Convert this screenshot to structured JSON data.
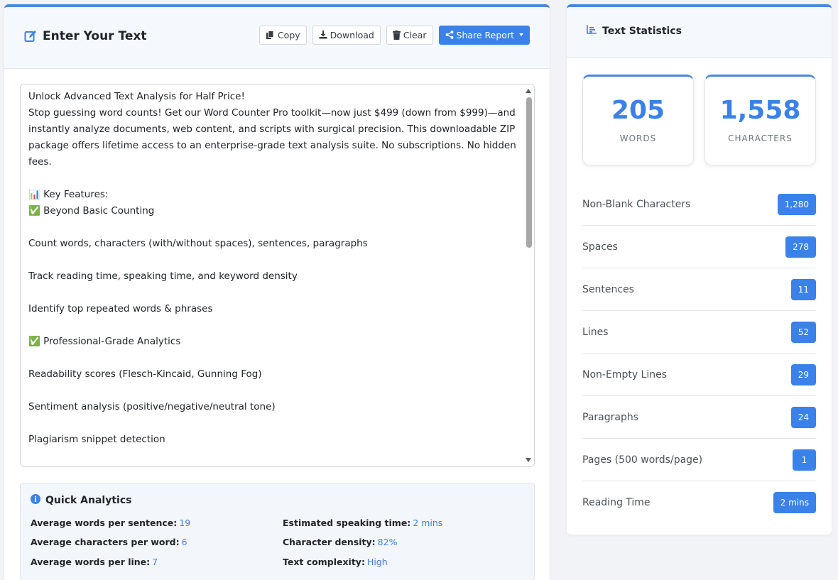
{
  "editor_panel": {
    "title": "Enter Your Text",
    "toolbar": {
      "copy": "Copy",
      "download": "Download",
      "clear": "Clear",
      "share": "Share Report"
    },
    "text": "Unlock Advanced Text Analysis for Half Price!\nStop guessing word counts! Get our Word Counter Pro toolkit—now just $499 (down from $999)—and instantly analyze documents, web content, and scripts with surgical precision. This downloadable ZIP package offers lifetime access to an enterprise-grade text analysis suite. No subscriptions. No hidden fees.\n\n📊 Key Features:\n✅ Beyond Basic Counting\n\nCount words, characters (with/without spaces), sentences, paragraphs\n\nTrack reading time, speaking time, and keyword density\n\nIdentify top repeated words & phrases\n\n✅ Professional-Grade Analytics\n\nReadability scores (Flesch-Kincaid, Gunning Fog)\n\nSentiment analysis (positive/negative/neutral tone)\n\nPlagiarism snippet detection"
  },
  "quick_analytics": {
    "title": "Quick Analytics",
    "items": [
      {
        "label": "Average words per sentence:",
        "value": "19"
      },
      {
        "label": "Average characters per word:",
        "value": "6"
      },
      {
        "label": "Average words per line:",
        "value": "7"
      },
      {
        "label": "Estimated speaking time:",
        "value": "2 mins"
      },
      {
        "label": "Character density:",
        "value": "82%"
      },
      {
        "label": "Text complexity:",
        "value": "High"
      }
    ]
  },
  "stats_panel": {
    "title": "Text Statistics",
    "cards": [
      {
        "value": "205",
        "label": "WORDS"
      },
      {
        "value": "1,558",
        "label": "CHARACTERS"
      }
    ],
    "items": [
      {
        "label": "Non-Blank Characters",
        "value": "1,280"
      },
      {
        "label": "Spaces",
        "value": "278"
      },
      {
        "label": "Sentences",
        "value": "11"
      },
      {
        "label": "Lines",
        "value": "52"
      },
      {
        "label": "Non-Empty Lines",
        "value": "29"
      },
      {
        "label": "Paragraphs",
        "value": "24"
      },
      {
        "label": "Pages (500 words/page)",
        "value": "1"
      },
      {
        "label": "Reading Time",
        "value": "2 mins"
      }
    ]
  },
  "colors": {
    "accent": "#3a82ea",
    "header_bg": "#f5f8fc",
    "page_bg": "#f1f3f6"
  }
}
